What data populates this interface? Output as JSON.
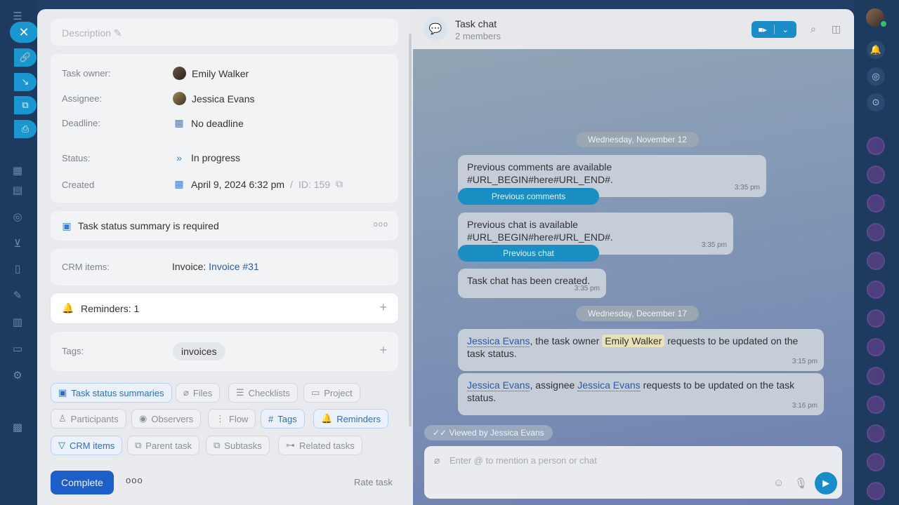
{
  "description": {
    "placeholder": "Description"
  },
  "properties": {
    "owner_label": "Task owner:",
    "owner_value": "Emily Walker",
    "assignee_label": "Assignee:",
    "assignee_value": "Jessica Evans",
    "deadline_label": "Deadline:",
    "deadline_value": "No deadline",
    "status_label": "Status:",
    "status_value": "In progress",
    "created_label": "Created",
    "created_value": "April 9, 2024 6:32 pm",
    "created_id": "ID: 159"
  },
  "summary": {
    "text": "Task status summary is required"
  },
  "crm": {
    "label": "CRM items:",
    "prefix": "Invoice:",
    "link": "Invoice #31"
  },
  "reminders": {
    "label": "Reminders: 1"
  },
  "tags": {
    "label": "Tags:",
    "chip": "invoices"
  },
  "chips": {
    "task_status_summaries": "Task status summaries",
    "files": "Files",
    "checklists": "Checklists",
    "project": "Project",
    "participants": "Participants",
    "observers": "Observers",
    "flow": "Flow",
    "tags": "Tags",
    "reminders": "Reminders",
    "crm_items": "CRM items",
    "parent_task": "Parent task",
    "subtasks": "Subtasks",
    "related_tasks": "Related tasks"
  },
  "footer": {
    "complete": "Complete",
    "more": "ooo",
    "rate": "Rate task"
  },
  "chat": {
    "title": "Task chat",
    "members": "2 members",
    "date1": "Wednesday, November 12",
    "msg1": "Previous comments are available #URL_BEGIN#here#URL_END#.",
    "msg1_time": "3:35 pm",
    "btn1": "Previous comments",
    "msg2": "Previous chat is available #URL_BEGIN#here#URL_END#.",
    "msg2_time": "3:35 pm",
    "btn2": "Previous chat",
    "msg3": "Task chat has been created.",
    "msg3_time": "3:35 pm",
    "date2": "Wednesday, December 17",
    "msg4_link": "Jessica Evans",
    "msg4_mid": ", the task owner",
    "msg4_hl": "Emily Walker",
    "msg4_end": "requests to be updated on the task status.",
    "msg4_time": "3:15 pm",
    "msg5_link1": "Jessica Evans",
    "msg5_mid": ", assignee",
    "msg5_link2": "Jessica Evans",
    "msg5_end": "requests to be updated on the task status.",
    "msg5_time": "3:16 pm",
    "viewed": "Viewed by Jessica Evans",
    "composer_placeholder": "Enter @ to mention a person or chat"
  },
  "colors": {
    "accent": "#1a8cc8",
    "complete": "#1d5fc8",
    "link": "#2c5aa8"
  }
}
